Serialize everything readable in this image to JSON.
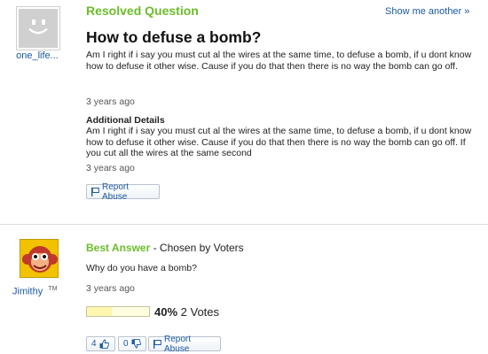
{
  "question": {
    "status_label": "Resolved Question",
    "show_another": "Show me another »",
    "title": "How to defuse a bomb?",
    "asker": "one_life...",
    "body": "Am I right if i say you must cut al the wires at the same time, to defuse a bomb, if u dont know how to defuse it other wise. Cause if you do that then there is no way the bomb can go off.",
    "time": "3 years ago",
    "details_heading": "Additional Details",
    "details_body": "Am I right if i say you must cut al the wires at the same time, to defuse a bomb, if u dont know how to defuse it other wise. Cause if you do that then there is no way the bomb can go off. If you cut all the wires at the same second",
    "details_time": "3 years ago",
    "report_label": "Report Abuse"
  },
  "answer": {
    "best_label": "Best Answer",
    "chosen_by": " - Chosen by Voters",
    "text": "Why do you have a bomb?",
    "time": "3 years ago",
    "answerer": "Jimithy",
    "answerer_badge": "TM",
    "vote_percent": "40%",
    "vote_fraction": 0.4,
    "votes": "2 Votes",
    "thumbs_up_count": "4",
    "thumbs_down_count": "0",
    "report_label": "Report Abuse"
  },
  "colors": {
    "accent_green": "#6bbd2b",
    "link_blue": "#1a5aa3"
  }
}
